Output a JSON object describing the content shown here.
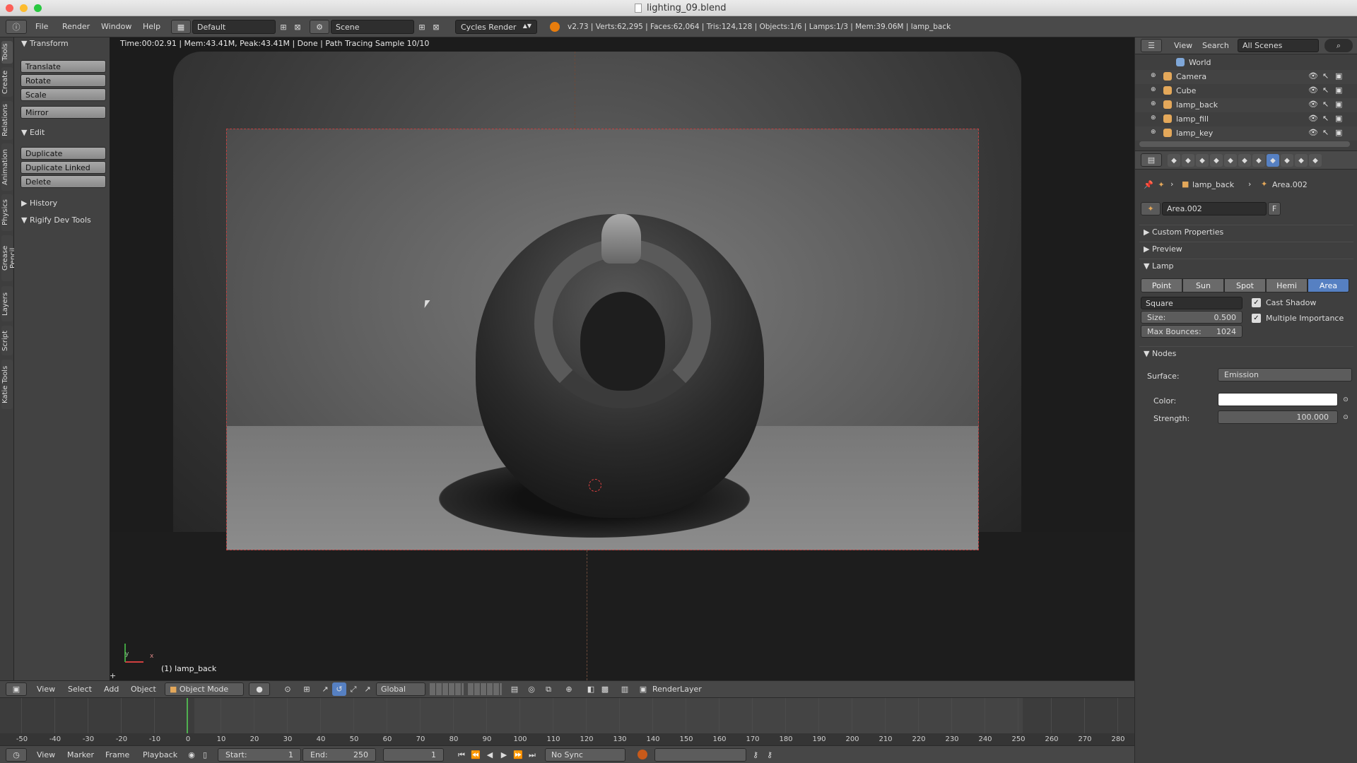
{
  "window": {
    "title": "lighting_09.blend"
  },
  "menubar": {
    "menus": [
      "File",
      "Render",
      "Window",
      "Help"
    ],
    "layout": "Default",
    "scene": "Scene",
    "engine": "Cycles Render",
    "stats": "v2.73 | Verts:62,295 | Faces:62,064 | Tris:124,128 | Objects:1/6 | Lamps:1/3 | Mem:39.06M | lamp_back"
  },
  "tool_tabs": [
    "Tools",
    "Create",
    "Relations",
    "Animation",
    "Physics",
    "Grease Pencil",
    "Layers",
    "Script",
    "Katie Tools"
  ],
  "tool_panel": {
    "transform": {
      "title": "Transform",
      "buttons": [
        "Translate",
        "Rotate",
        "Scale",
        "Mirror"
      ]
    },
    "edit": {
      "title": "Edit",
      "buttons": [
        "Duplicate",
        "Duplicate Linked",
        "Delete"
      ]
    },
    "history": "History",
    "rigify": "Rigify Dev Tools"
  },
  "viewport": {
    "render_status": "Time:00:02.91 | Mem:43.41M, Peak:43.41M | Done | Path Tracing Sample 10/10",
    "object_label": "(1) lamp_back",
    "axis_y": "y",
    "axis_x": "x"
  },
  "view3d_header": {
    "menus": [
      "View",
      "Select",
      "Add",
      "Object"
    ],
    "mode": "Object Mode",
    "orientation": "Global",
    "render_layer": "RenderLayer"
  },
  "timeline": {
    "ticks": [
      "-50",
      "-40",
      "-30",
      "-20",
      "-10",
      "0",
      "10",
      "20",
      "30",
      "40",
      "50",
      "60",
      "70",
      "80",
      "90",
      "100",
      "110",
      "120",
      "130",
      "140",
      "150",
      "160",
      "170",
      "180",
      "190",
      "200",
      "210",
      "220",
      "230",
      "240",
      "250",
      "260",
      "270",
      "280"
    ],
    "menus": [
      "View",
      "Marker",
      "Frame",
      "Playback"
    ],
    "start_label": "Start:",
    "start": "1",
    "end_label": "End:",
    "end": "250",
    "current": "1",
    "sync": "No Sync",
    "current_frame": 0,
    "frame_min": -50,
    "frame_max": 280
  },
  "outliner": {
    "menus": [
      "View",
      "Search"
    ],
    "filter": "All Scenes",
    "items": [
      {
        "name": "World",
        "color": "#7fa7d8"
      },
      {
        "name": "Camera",
        "color": "#e4a85a"
      },
      {
        "name": "Cube",
        "color": "#e4a85a"
      },
      {
        "name": "lamp_back",
        "color": "#e4a85a"
      },
      {
        "name": "lamp_fill",
        "color": "#e4a85a"
      },
      {
        "name": "lamp_key",
        "color": "#e4a85a"
      }
    ]
  },
  "properties": {
    "breadcrumb_object": "lamp_back",
    "breadcrumb_data": "Area.002",
    "datablock": "Area.002",
    "fake_user": "F",
    "panels": {
      "custom": "Custom Properties",
      "preview": "Preview",
      "lamp": "Lamp",
      "nodes": "Nodes"
    },
    "lamp_types": [
      "Point",
      "Sun",
      "Spot",
      "Hemi",
      "Area"
    ],
    "active_lamp_type": "Area",
    "shape": "Square",
    "size_label": "Size:",
    "size": "0.500",
    "bounces_label": "Max Bounces:",
    "bounces": "1024",
    "cast_shadow": "Cast Shadow",
    "multiple_importance": "Multiple Importance",
    "surface_label": "Surface:",
    "surface": "Emission",
    "color_label": "Color:",
    "color_value": "#ffffff",
    "strength_label": "Strength:",
    "strength": "100.000"
  },
  "colors": {
    "accent": "#5680c2",
    "render_border": "#c04040"
  }
}
